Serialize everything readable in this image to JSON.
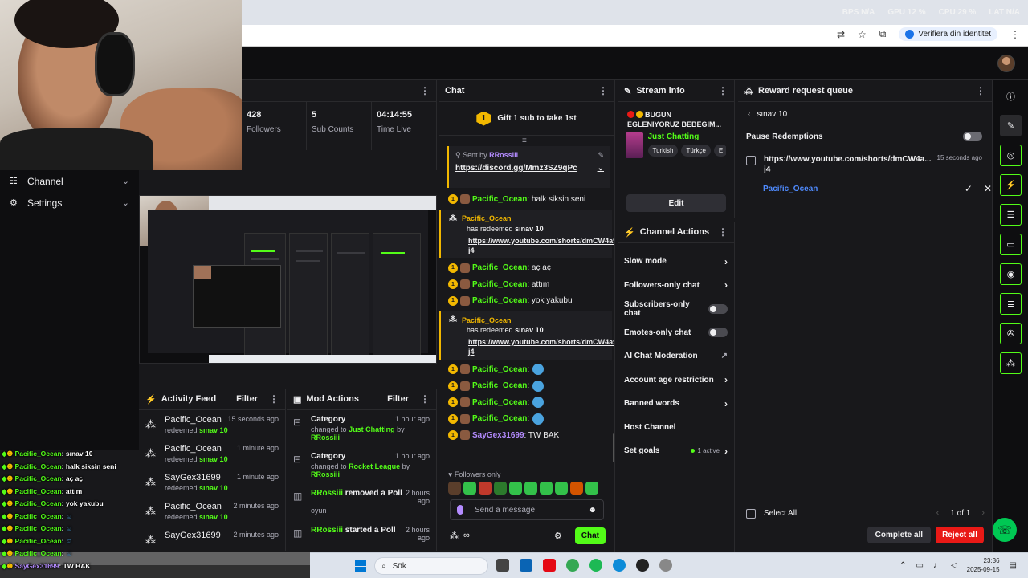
{
  "overlay_stats": {
    "bps": "BPS N/A",
    "gpu": "GPU 12 %",
    "cpu": "CPU 29 %",
    "lat": "LAT N/A"
  },
  "browser": {
    "verify_label": "Verifiera din identitet"
  },
  "leftnav": {
    "items": [
      {
        "label": "Channel"
      },
      {
        "label": "Settings"
      }
    ]
  },
  "stats": {
    "followers": {
      "value": "428",
      "label": "Followers"
    },
    "subs": {
      "value": "5",
      "label": "Sub Counts"
    },
    "time": {
      "value": "04:14:55",
      "label": "Time Live"
    }
  },
  "activity": {
    "title": "Activity Feed",
    "filter": "Filter",
    "items": [
      {
        "name": "Pacific_Ocean",
        "time": "15 seconds ago",
        "action": "redeemed",
        "reward": "sınav 10"
      },
      {
        "name": "Pacific_Ocean",
        "time": "1 minute ago",
        "action": "redeemed",
        "reward": "sınav 10"
      },
      {
        "name": "SayGex31699",
        "time": "1 minute ago",
        "action": "redeemed",
        "reward": "sınav 10"
      },
      {
        "name": "Pacific_Ocean",
        "time": "2 minutes ago",
        "action": "redeemed",
        "reward": "sınav 10"
      },
      {
        "name": "SayGex31699",
        "time": "2 minutes ago",
        "action": "",
        "reward": ""
      }
    ]
  },
  "mod_actions": {
    "title": "Mod Actions",
    "filter": "Filter",
    "items": [
      {
        "title": "Category",
        "time": "1 hour ago",
        "pre": "changed to",
        "target": "Just Chatting",
        "by": "by",
        "user": "RRossiii"
      },
      {
        "title": "Category",
        "time": "1 hour ago",
        "pre": "changed to",
        "target": "Rocket League",
        "by": "by",
        "user": "RRossiii"
      },
      {
        "user_title": "RRossiii",
        "title_rest": "removed a Poll",
        "time": "2 hours ago",
        "sub": "oyun"
      },
      {
        "user_title": "RRossiii",
        "title_rest": "started a Poll",
        "time": "2 hours ago",
        "sub": ""
      }
    ]
  },
  "overlay_chat": [
    {
      "name": "Pacific_Ocean",
      "text": ": sınav 10"
    },
    {
      "name": "Pacific_Ocean",
      "text": ": halk siksin seni"
    },
    {
      "name": "Pacific_Ocean",
      "text": ": aç aç"
    },
    {
      "name": "Pacific_Ocean",
      "text": ": attım"
    },
    {
      "name": "Pacific_Ocean",
      "text": ": yok yakubu"
    },
    {
      "name": "Pacific_Ocean",
      "text": ":"
    },
    {
      "name": "Pacific_Ocean",
      "text": ":"
    },
    {
      "name": "Pacific_Ocean",
      "text": ":"
    },
    {
      "name": "Pacific_Ocean",
      "text": ":"
    },
    {
      "name": "SayGex31699",
      "text": ": TW BAK"
    }
  ],
  "chat": {
    "title": "Chat",
    "gift_badge": "1",
    "gift_text": "Gift 1 sub to take 1st",
    "pinned_by_label": "Sent by",
    "pinned_user": "RRossiii",
    "pinned_link": "https://discord.gg/Mmz3SZ9qPc",
    "badge_text": "1",
    "msg1": {
      "name": "Pacific_Ocean",
      "text": ": halk siksin seni"
    },
    "redeem1": {
      "name": "Pacific_Ocean",
      "text": "has redeemed",
      "reward": "sınav 10",
      "link": "https://www.youtube.com/shorts/dmCW4a9m-j4"
    },
    "msg2": {
      "name": "Pacific_Ocean",
      "text": ": aç aç"
    },
    "msg3": {
      "name": "Pacific_Ocean",
      "text": ": attım"
    },
    "msg4": {
      "name": "Pacific_Ocean",
      "text": ": yok yakubu"
    },
    "redeem2": {
      "name": "Pacific_Ocean",
      "text": "has redeemed",
      "reward": "sınav 10",
      "link": "https://www.youtube.com/shorts/dmCW4a9m-j4"
    },
    "msg5": {
      "name": "Pacific_Ocean",
      "text": ":"
    },
    "msg6": {
      "name": "Pacific_Ocean",
      "text": ":"
    },
    "msg7": {
      "name": "Pacific_Ocean",
      "text": ":"
    },
    "msg8": {
      "name": "Pacific_Ocean",
      "text": ":"
    },
    "msg9": {
      "name": "SayGex31699",
      "text": ": TW BAK"
    },
    "followers_only": "♥ Followers only",
    "input_placeholder": "Send a message",
    "send_label": "Chat"
  },
  "stream_info": {
    "title": "Stream info",
    "stream_title": "BUGUN EGLENIYORUZ BEBEGIM...",
    "category": "Just Chatting",
    "tags": [
      "Turkish",
      "Türkçe",
      "E"
    ],
    "edit_label": "Edit"
  },
  "channel_actions": {
    "title": "Channel Actions",
    "slow": "Slow mode",
    "followers": "Followers-only chat",
    "subscribers": "Subscribers-only chat",
    "emotes": "Emotes-only chat",
    "ai": "AI Chat Moderation",
    "account_age": "Account age restriction",
    "banned": "Banned words",
    "host": "Host Channel",
    "goals": "Set goals",
    "goals_note": "1 active"
  },
  "reward_queue": {
    "title": "Reward request queue",
    "back_label": "sınav 10",
    "pause_label": "Pause Redemptions",
    "item": {
      "link": "https://www.youtube.com/shorts/dmCW4a...j4",
      "time": "15 seconds ago",
      "user": "Pacific_Ocean"
    },
    "select_all": "Select All",
    "page": "1 of 1",
    "complete_all": "Complete all",
    "reject_all": "Reject all"
  },
  "taskbar": {
    "search_placeholder": "Sök",
    "time": "23:36",
    "date": "2025-09-15"
  },
  "colors": {
    "accent": "#53fc18",
    "reject": "#e91916",
    "badge": "#f2b800",
    "bg": "#18181b"
  }
}
